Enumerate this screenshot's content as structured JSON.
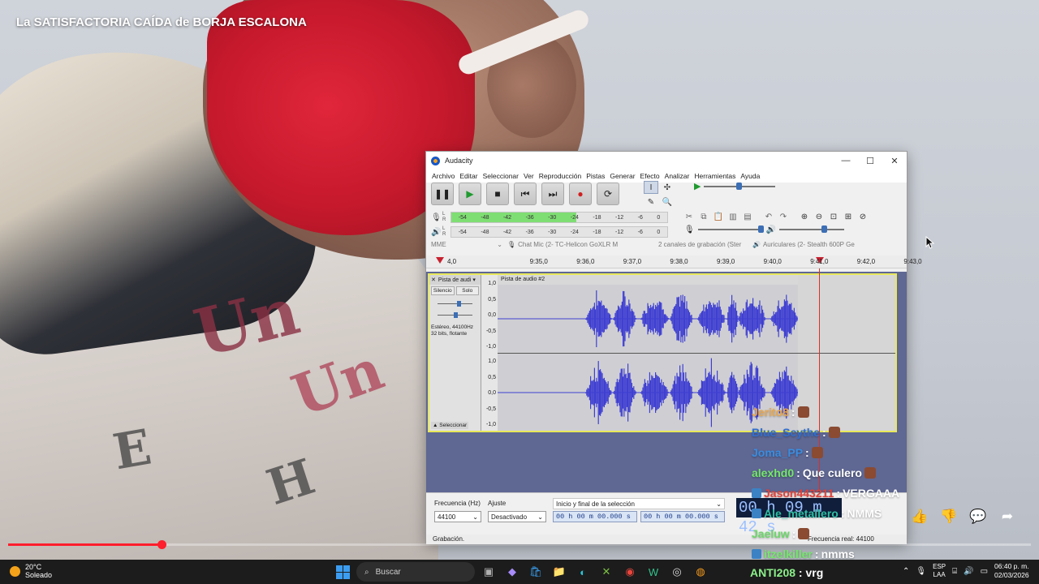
{
  "video": {
    "title": "La SATISFACTORIA CAÍDA de BORJA ESCALONA",
    "print_letters": [
      "Un",
      "Un",
      "E",
      "H"
    ],
    "progress": 0.15,
    "actions": [
      {
        "name": "like-button",
        "icon": "thumbs-up-icon",
        "glyph": "👍"
      },
      {
        "name": "dislike-button",
        "icon": "thumbs-down-icon",
        "glyph": "👎"
      },
      {
        "name": "comments-button",
        "icon": "comment-icon",
        "glyph": "💬"
      },
      {
        "name": "share-button",
        "icon": "share-icon",
        "glyph": "➦"
      }
    ]
  },
  "audacity": {
    "title": "Audacity",
    "window_controls": [
      "—",
      "☐",
      "✕"
    ],
    "menu": [
      "Archivo",
      "Editar",
      "Seleccionar",
      "Ver",
      "Reproducción",
      "Pistas",
      "Generar",
      "Efecto",
      "Analizar",
      "Herramientas",
      "Ayuda"
    ],
    "transport": [
      {
        "name": "pause-button",
        "glyph": "❚❚"
      },
      {
        "name": "play-button",
        "glyph": "▶"
      },
      {
        "name": "stop-button",
        "glyph": "■"
      },
      {
        "name": "skip-start-button",
        "glyph": "⏮"
      },
      {
        "name": "skip-end-button",
        "glyph": "⏭"
      },
      {
        "name": "record-button",
        "glyph": "●"
      },
      {
        "name": "loop-button",
        "glyph": "⟳"
      }
    ],
    "tools": [
      {
        "name": "selection-tool-icon",
        "glyph": "I"
      },
      {
        "name": "envelope-tool-icon",
        "glyph": "✣"
      },
      {
        "name": "draw-tool-icon",
        "glyph": "✎"
      },
      {
        "name": "zoom-tool-icon",
        "glyph": "🔍"
      },
      {
        "name": "multi-tool-icon",
        "glyph": "✳"
      }
    ],
    "meter_labels": [
      "-54",
      "-48",
      "-42",
      "-36",
      "-30",
      "-24",
      "-18",
      "-12",
      "-6",
      "0"
    ],
    "record_meter_level": 0.58,
    "playback_meter_level": 0,
    "devices": {
      "host": "MME",
      "recording_device": "Chat Mic (2- TC-Helicon GoXLR M",
      "channels": "2 canales de grabación (Ster",
      "playback_device": "Auriculares (2- Stealth 600P Ge"
    },
    "ruler": [
      "4,0",
      "9:35,0",
      "9:36,0",
      "9:37,0",
      "9:38,0",
      "9:39,0",
      "9:40,0",
      "9:41,0",
      "9:42,0",
      "9:43,0"
    ],
    "track": {
      "name": "Pista de audi",
      "mute": "Silencio",
      "solo": "Solo",
      "info_rate": "Estéreo, 44100Hz",
      "info_format": "32 bits, flotante",
      "select": "Seleccionar",
      "clip_name": "Pista de audio #2",
      "scale": [
        "1,0",
        "0,5",
        "0,0",
        "-0,5",
        "-1,0"
      ]
    },
    "selection_bar": {
      "rate_label": "Frecuencia (Hz)",
      "rate_value": "44100",
      "snap_label": "Ajuste",
      "snap_value": "Desactivado",
      "mode": "Inicio y final de la selección",
      "start": "00 h 00 m 00.000 s",
      "end": "00 h 00 m 00.000 s",
      "big_time": "00 h 09 m 42 s"
    },
    "status": "Grabación.",
    "status_rate": "Frecuencia real: 44100",
    "colors": {
      "wave": "#3f3fd2",
      "meter": "#7fde73",
      "record": "#d02020"
    }
  },
  "chat": [
    {
      "user": "Jerito8",
      "color": "#e9a64b",
      "msg": "",
      "emote": true
    },
    {
      "user": "Blue_Scythe",
      "color": "#2f6fd1",
      "msg": "",
      "emote": true
    },
    {
      "user": "Joma_PP",
      "color": "#3b8de0",
      "msg": "",
      "emote": true
    },
    {
      "user": "alexhd0",
      "color": "#74e86a",
      "msg": "Que culero",
      "emote": true
    },
    {
      "user": "Jason443211",
      "color": "#e0423a",
      "msg": "VERGAAA",
      "emote": false
    },
    {
      "user": "Ale_metallero",
      "color": "#2ebfa3",
      "msg": "NMMS",
      "emote": false
    },
    {
      "user": "Jaeluw",
      "color": "#6cd66a",
      "msg": "",
      "emote": true
    },
    {
      "user": "itzelkiller",
      "color": "#74e86a",
      "msg": "nmms",
      "emote": false
    }
  ],
  "taskbar": {
    "temperature": "20°C",
    "weather": "Soleado",
    "search": "Buscar",
    "overlay_user": "ANTI208",
    "overlay_msg": "vrg",
    "lang_top": "ESP",
    "lang_bottom": "LAA",
    "time": "06:40 p. m.",
    "date": "02/03/2026",
    "apps": [
      {
        "name": "files-app-icon",
        "glyph": "▣",
        "color": "#b0b0b0"
      },
      {
        "name": "copilot-app-icon",
        "glyph": "◆",
        "color": "#a78bfa"
      },
      {
        "name": "store-app-icon",
        "glyph": "🛍",
        "color": "#3aa0f0"
      },
      {
        "name": "explorer-app-icon",
        "glyph": "📁",
        "color": "#f4c542"
      },
      {
        "name": "edge-app-icon",
        "glyph": "◐",
        "color": "#2ec2d6"
      },
      {
        "name": "terminal-app-icon",
        "glyph": "✕",
        "color": "#7bc043"
      },
      {
        "name": "chrome-app-icon",
        "glyph": "◉",
        "color": "#e8453c"
      },
      {
        "name": "streamlabs-app-icon",
        "glyph": "W",
        "color": "#31c48d"
      },
      {
        "name": "github-app-icon",
        "glyph": "◎",
        "color": "#dcdcdc"
      },
      {
        "name": "audacity-app-icon",
        "glyph": "◍",
        "color": "#f59a1b"
      }
    ]
  }
}
